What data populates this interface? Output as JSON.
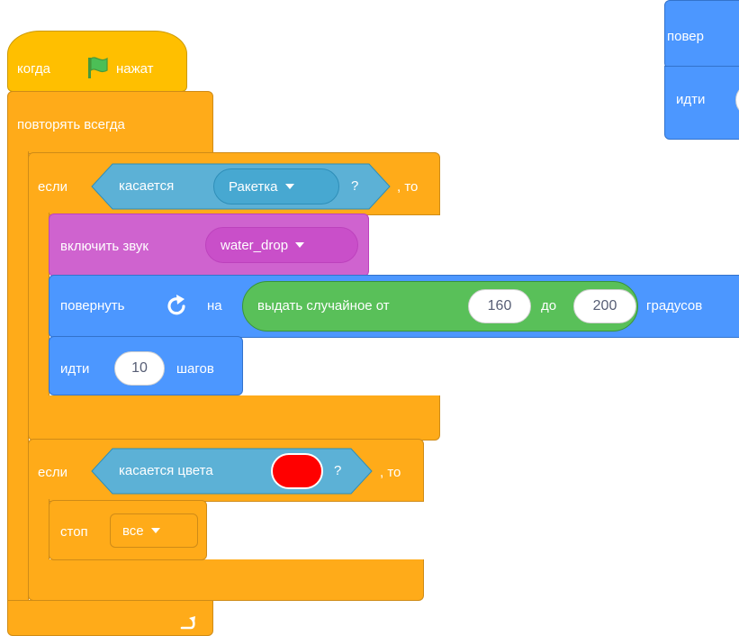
{
  "script_main": {
    "hat": {
      "label_before": "когда",
      "label_after": "нажат",
      "icon": "green-flag-icon"
    },
    "forever": {
      "label": "повторять всегда",
      "loop_icon": "loop-arrow-icon"
    },
    "if1": {
      "label_if": "если",
      "label_then": ", то",
      "condition": {
        "label": "касается",
        "dropdown_value": "Ракетка",
        "question": "?"
      },
      "body": {
        "sound": {
          "label": "включить звук",
          "dropdown_value": "water_drop"
        },
        "turn": {
          "label_before": "повернуть",
          "icon": "rotate-right-icon",
          "label_on": "на",
          "random": {
            "label_from": "выдать случайное от",
            "from": "160",
            "label_to": "до",
            "to": "200"
          },
          "label_after": "градусов"
        },
        "move": {
          "label": "идти",
          "steps": "10",
          "label_after": "шагов"
        }
      }
    },
    "if2": {
      "label_if": "если",
      "label_then": ", то",
      "condition": {
        "label": "касается цвета",
        "color": "#FF0000",
        "question": "?"
      },
      "body": {
        "stop": {
          "label": "стоп",
          "dropdown_value": "все"
        }
      }
    }
  },
  "script_side": {
    "turn_label_partial": "повер",
    "move_label_partial": "идти"
  },
  "colors": {
    "control": "#FFAB19",
    "events": "#FFBF00",
    "motion": "#4C97FF",
    "sound": "#CF63CF",
    "sensing": "#5CB1D6",
    "operators": "#59C059"
  }
}
